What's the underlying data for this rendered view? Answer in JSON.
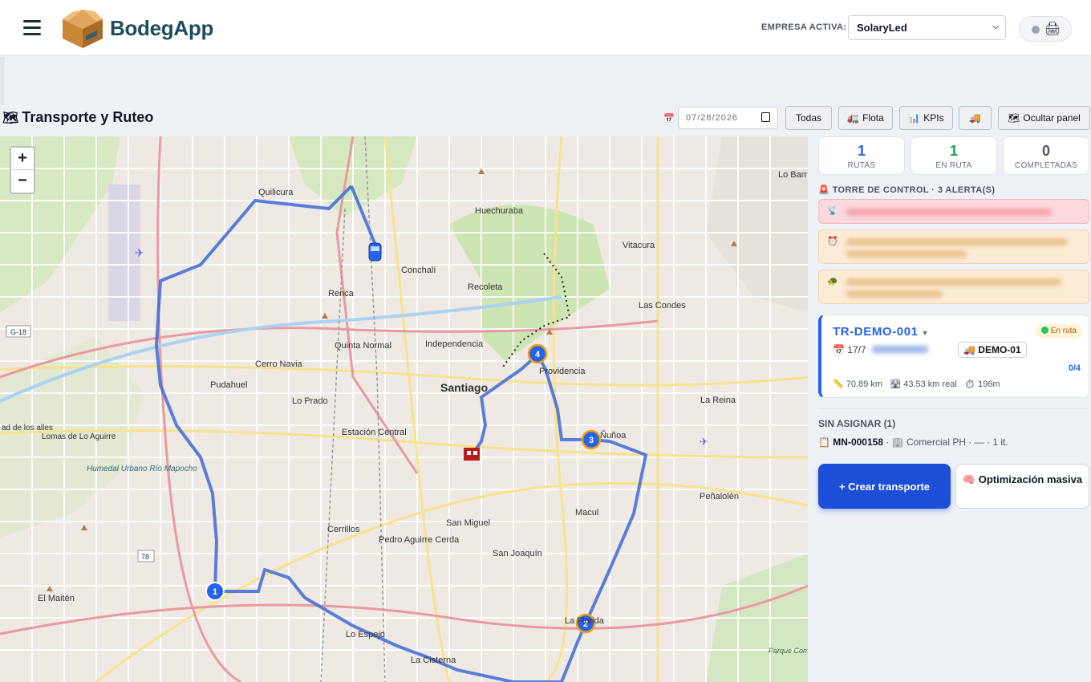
{
  "header": {
    "brand": "BodegApp",
    "empresa_label": "EMPRESA ACTIVA:",
    "empresa_value": "SolaryLed"
  },
  "page": {
    "title": "Transporte y Ruteo",
    "date_value": "07/28/2026",
    "buttons": {
      "todas": "Todas",
      "flota": "Flota",
      "kpis": "KPIs",
      "ocultar": "Ocultar panel"
    }
  },
  "map": {
    "zoom_in": "+",
    "zoom_out": "−",
    "stops": [
      "1",
      "2",
      "3",
      "4"
    ],
    "labels": {
      "quilicura": "Quilicura",
      "huechuraba": "Huechuraba",
      "vitacura": "Vitacura",
      "conchali": "Conchalí",
      "recoleta": "Recoleta",
      "renca": "Renca",
      "las_condes": "Las Condes",
      "quinta_normal": "Quinta Normal",
      "independencia": "Independencia",
      "cerro_navia": "Cerro Navia",
      "providencia": "Providencia",
      "santiago": "Santiago",
      "pudahuel": "Pudahuel",
      "lo_prado": "Lo Prado",
      "la_reina": "La Reina",
      "estacion_central": "Estación Central",
      "nunoa": "Ñuñoa",
      "lomas": "Lomas de Lo Aguirre",
      "humedal": "Humedal Urbano Río Mapocho",
      "penalolen": "Peñalolén",
      "macul": "Macul",
      "cerrillos": "Cerrillos",
      "san_miguel": "San Miguel",
      "pedro_aguirre": "Pedro Aguirre Cerda",
      "san_joaquin": "San Joaquín",
      "el_maiten": "El Maitén",
      "la_florida": "La Florida",
      "lo_espejo": "Lo Espejo",
      "la_cisterna": "La Cisterna",
      "parque": "Parque Comunitario Bosque Pantanal",
      "lo_barr": "Lo Barr",
      "g18": "G-18",
      "r78": "78",
      "idalos": "ad de los alles"
    }
  },
  "panel": {
    "kpis": [
      {
        "value": "1",
        "label": "RUTAS",
        "color": "#2563eb"
      },
      {
        "value": "1",
        "label": "EN RUTA",
        "color": "#16a34a"
      },
      {
        "value": "0",
        "label": "COMPLETADAS",
        "color": "#4b5563"
      }
    ],
    "control_tower": "TORRE DE CONTROL · 3 ALERTA(S)",
    "alert_icons": [
      "satellite-icon",
      "alarm-clock-icon",
      "turtle-icon"
    ],
    "route": {
      "id": "TR-DEMO-001",
      "status": "En ruta",
      "date": "17/7",
      "vehicle": "DEMO-01",
      "progress": "0/4",
      "distance": "70.89 km",
      "real_distance": "43.53 km real",
      "duration": "196m"
    },
    "unassigned_header": "SIN ASIGNAR (1)",
    "order": {
      "id": "MN-000158",
      "detail": "Comercial PH · — · 1 it."
    },
    "create_button": "+ Crear transporte",
    "optimize_button": "Optimización masiva"
  }
}
